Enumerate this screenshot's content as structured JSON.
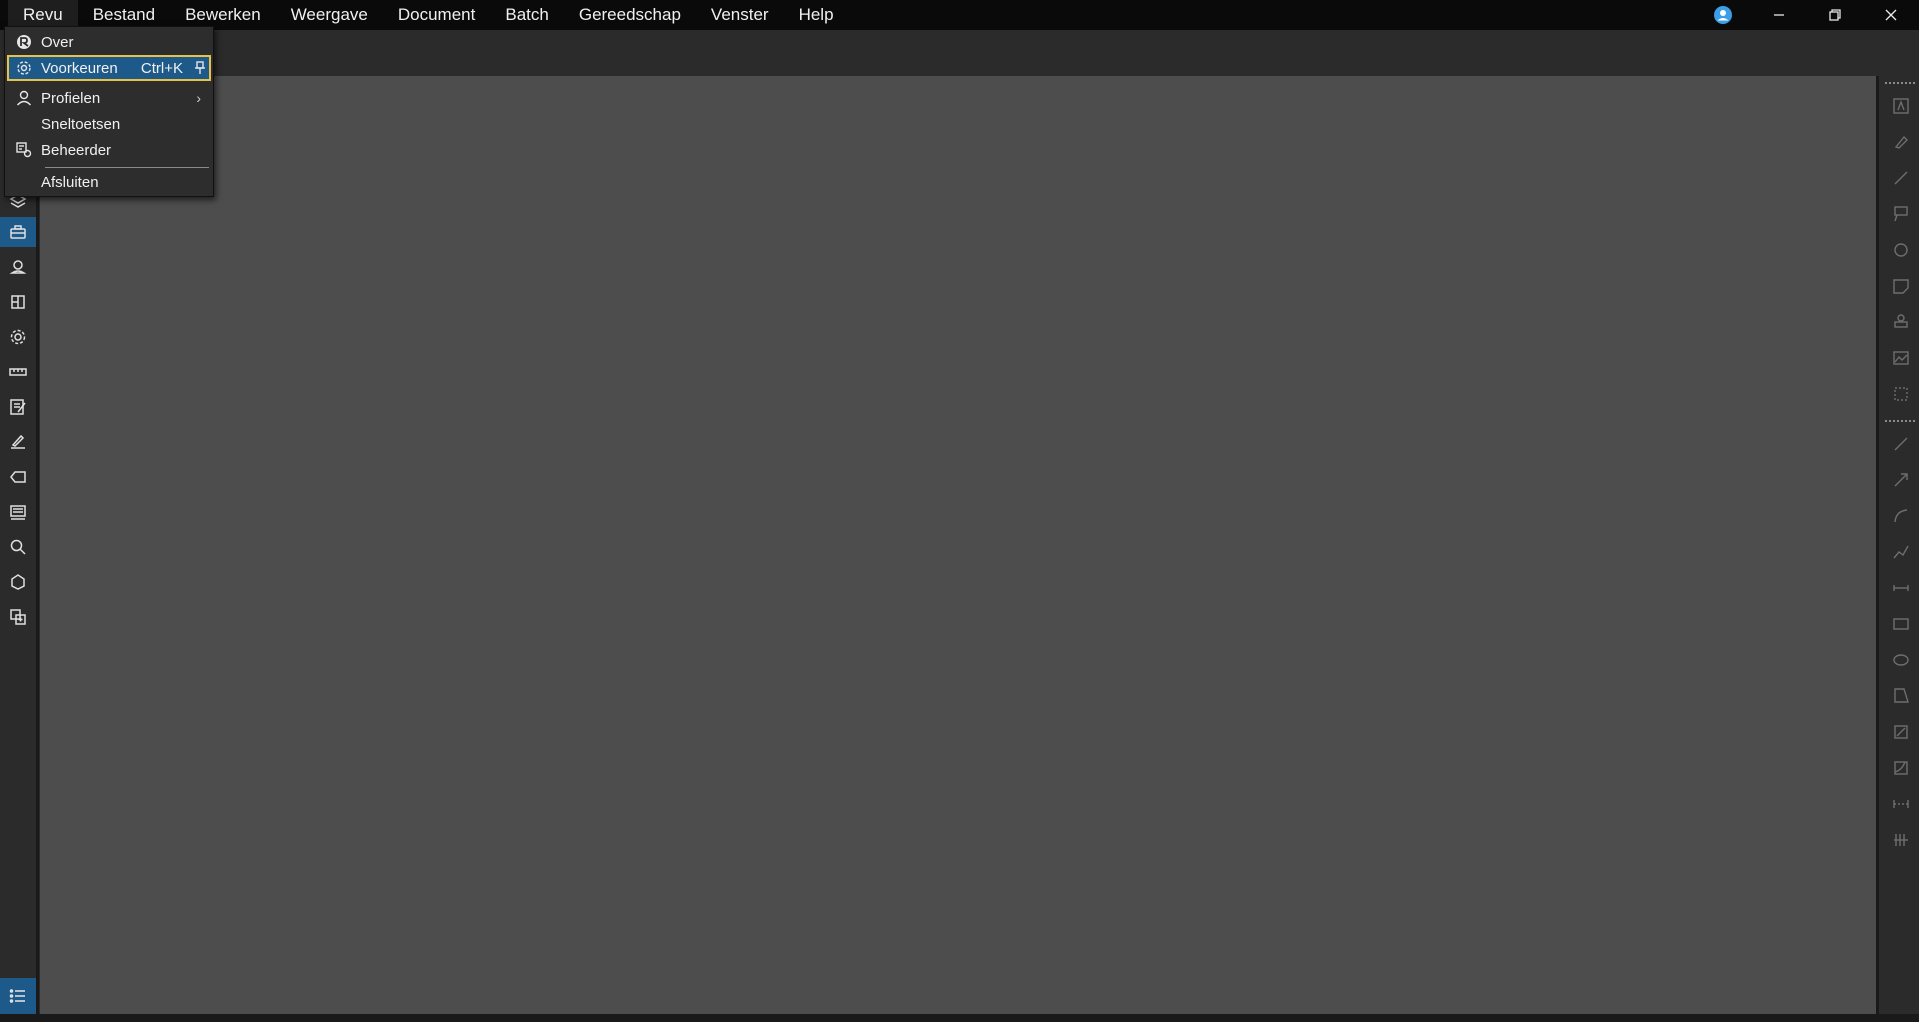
{
  "menubar": {
    "items": [
      "Revu",
      "Bestand",
      "Bewerken",
      "Weergave",
      "Document",
      "Batch",
      "Gereedschap",
      "Venster",
      "Help"
    ],
    "active_index": 0
  },
  "dropdown": {
    "over": "Over",
    "voorkeuren": "Voorkeuren",
    "voorkeuren_shortcut": "Ctrl+K",
    "profielen": "Profielen",
    "sneltoetsen": "Sneltoetsen",
    "beheerder": "Beheerder",
    "afsluiten": "Afsluiten",
    "submenu_arrow": "›"
  },
  "icons": {
    "left_rail": [
      "layers-icon",
      "toolbox-icon",
      "location-pin-icon",
      "studio-icon",
      "settings-icon",
      "ruler-icon",
      "markup-list-icon",
      "signature-icon",
      "tag-icon",
      "stamp-icon",
      "search-icon",
      "shapes-icon",
      "add-icon"
    ],
    "bottom": "list-icon"
  },
  "colors": {
    "accent": "#1d5a8a",
    "highlight_border": "#e8c14a",
    "menubar": "#0a0a0a",
    "canvas": "#4d4d4d"
  }
}
